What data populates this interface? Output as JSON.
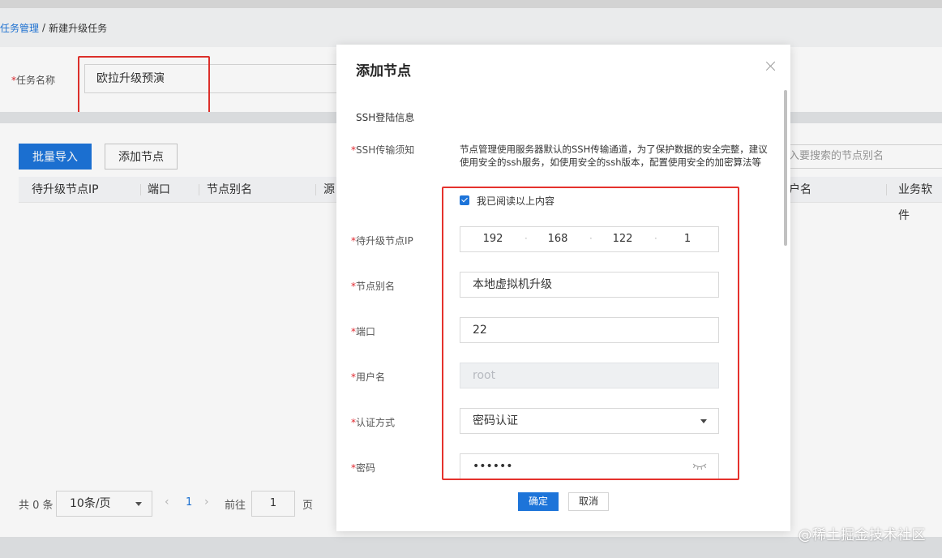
{
  "breadcrumb": {
    "parent": "任务管理",
    "separator": "/",
    "current": "新建升级任务"
  },
  "task_form": {
    "required_mark": "*",
    "label": "任务名称",
    "value": "欧拉升级预演"
  },
  "list": {
    "batch_import_label": "批量导入",
    "add_node_label": "添加节点",
    "search_placeholder": "入要搜索的节点别名",
    "columns": [
      "待升级节点IP",
      "端口",
      "节点别名",
      "源",
      "户名",
      "业务软件"
    ]
  },
  "pagination": {
    "total": "共 0 条",
    "page_size": "10条/页",
    "prev": "‹",
    "current_page": "1",
    "next": "›",
    "goto_label": "前往",
    "goto_value": "1",
    "unit": "页"
  },
  "modal": {
    "title": "添加节点",
    "section": "SSH登陆信息",
    "required_mark": "*",
    "notice_label": "SSH传输须知",
    "notice_text": "节点管理使用服务器默认的SSH传输通道，为了保护数据的安全完整，建议使用安全的ssh服务，如使用安全的ssh版本，配置使用安全的加密算法等",
    "read_confirm": "我已阅读以上内容",
    "ip_label": "待升级节点IP",
    "ip": [
      "192",
      "168",
      "122",
      "1"
    ],
    "ip_separator": "·",
    "alias_label": "节点别名",
    "alias_value": "本地虚拟机升级",
    "port_label": "端口",
    "port_value": "22",
    "username_label": "用户名",
    "username_value": "root",
    "auth_label": "认证方式",
    "auth_value": "密码认证",
    "password_label": "密码",
    "password_value": "••••••",
    "confirm_label": "确定",
    "cancel_label": "取消"
  },
  "watermark": "@稀土掘金技术社区",
  "colors": {
    "primary": "#1d74d9",
    "annotation": "#e5322d",
    "required": "#e0282f"
  }
}
